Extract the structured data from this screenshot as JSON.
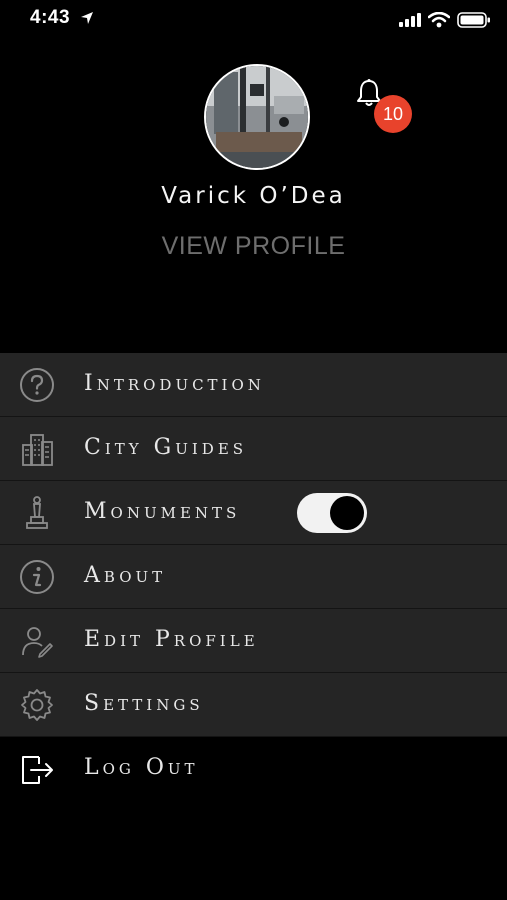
{
  "status_bar": {
    "time": "4:43"
  },
  "header": {
    "user_name": "Varick O’Dea",
    "view_profile_label": "VIEW PROFILE",
    "notification_count": "10"
  },
  "menu": {
    "items": [
      {
        "label": "Introduction",
        "icon": "question-circle-icon"
      },
      {
        "label": "City Guides",
        "icon": "city-buildings-icon"
      },
      {
        "label": "Monuments",
        "icon": "monument-icon",
        "toggle_on": true
      },
      {
        "label": "About",
        "icon": "info-circle-icon"
      },
      {
        "label": "Edit Profile",
        "icon": "user-edit-icon"
      },
      {
        "label": "Settings",
        "icon": "gear-icon"
      },
      {
        "label": "Log Out",
        "icon": "logout-icon"
      }
    ]
  },
  "colors": {
    "background": "#000000",
    "menu_row": "#252525",
    "badge": "#e8432c",
    "muted_text": "#6e6e6e"
  }
}
